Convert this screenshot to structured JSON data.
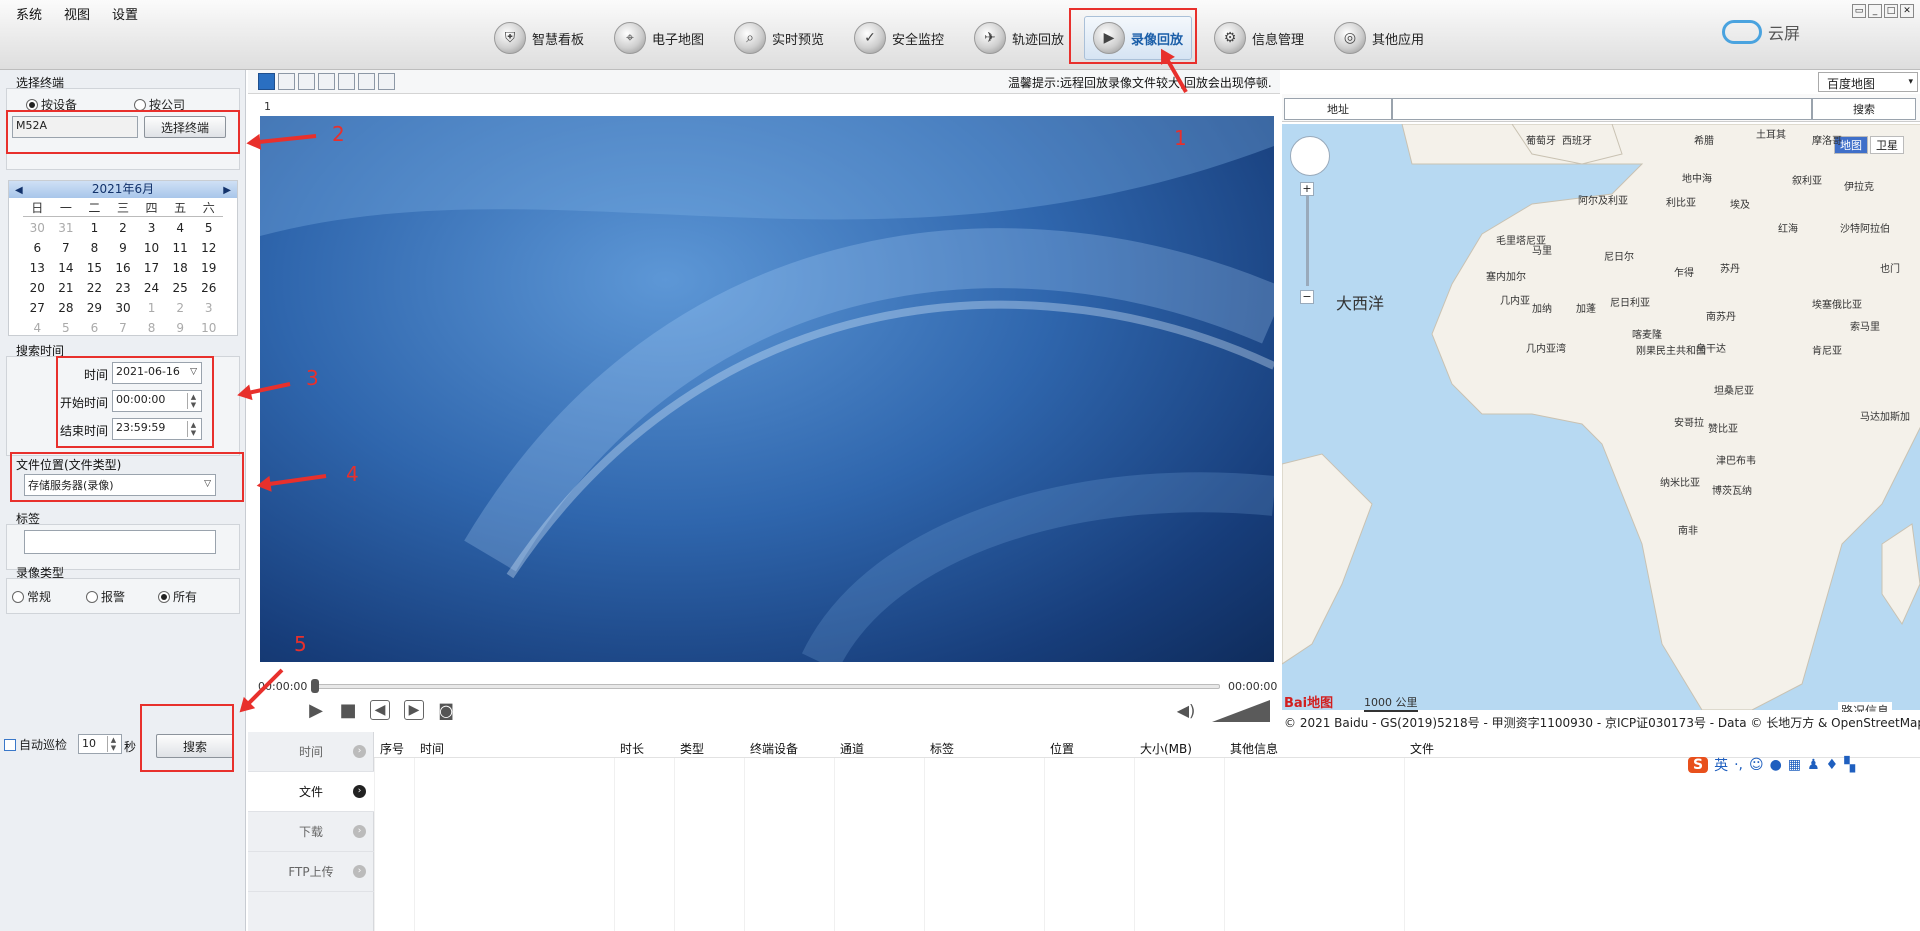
{
  "menu": [
    "系统",
    "视图",
    "设置"
  ],
  "nav": [
    {
      "label": "智慧看板",
      "icon": "shield-icon"
    },
    {
      "label": "电子地图",
      "icon": "map-pin-icon"
    },
    {
      "label": "实时预览",
      "icon": "search-icon"
    },
    {
      "label": "安全监控",
      "icon": "shield-check-icon"
    },
    {
      "label": "轨迹回放",
      "icon": "track-icon"
    },
    {
      "label": "录像回放",
      "icon": "playback-icon"
    },
    {
      "label": "信息管理",
      "icon": "gear-icon"
    },
    {
      "label": "其他应用",
      "icon": "apps-icon"
    }
  ],
  "logo": "云屏",
  "terminal": {
    "title": "选择终端",
    "by_device": "按设备",
    "by_company": "按公司",
    "value": "M52A",
    "select_button": "选择终端"
  },
  "calendar": {
    "month": "2021年6月",
    "weekdays": [
      "日",
      "一",
      "二",
      "三",
      "四",
      "五",
      "六"
    ],
    "days": [
      "30",
      "31",
      "1",
      "2",
      "3",
      "4",
      "5",
      "6",
      "7",
      "8",
      "9",
      "10",
      "11",
      "12",
      "13",
      "14",
      "15",
      "16",
      "17",
      "18",
      "19",
      "20",
      "21",
      "22",
      "23",
      "24",
      "25",
      "26",
      "27",
      "28",
      "29",
      "30",
      "1",
      "2",
      "3",
      "4",
      "5",
      "6",
      "7",
      "8",
      "9",
      "10"
    ]
  },
  "search_time": {
    "title": "搜索时间",
    "date_label": "时间",
    "date_value": "2021-06-16",
    "start_label": "开始时间",
    "start_value": "00:00:00",
    "end_label": "结束时间",
    "end_value": "23:59:59"
  },
  "file_location": {
    "title": "文件位置(文件类型)",
    "value": "存储服务器(录像)"
  },
  "tag": {
    "title": "标签",
    "value": ""
  },
  "record_type": {
    "title": "录像类型",
    "options": [
      "常规",
      "报警",
      "所有"
    ],
    "selected": "所有"
  },
  "auto_patrol": {
    "label": "自动巡检",
    "value": "10",
    "unit": "秒"
  },
  "search_button": "搜索",
  "annotations": [
    "1",
    "2",
    "3",
    "4",
    "5"
  ],
  "hint": "温馨提示:远程回放录像文件较大,回放会出现停顿.",
  "channel": "1",
  "player": {
    "current": "00:00:00",
    "total": "00:00:00",
    "progress": 0
  },
  "map": {
    "type": "百度地图",
    "address_label": "地址",
    "search": "搜索",
    "map_tab": "地图",
    "satellite_tab": "卫星",
    "ocean": "大西洋",
    "scale": "1000 公里",
    "traffic": "路况信息",
    "copyright": "© 2021 Baidu - GS(2019)5218号 - 甲测资字1100930 - 京ICP证030173号 - Data © 长地万方 & OpenStreetMap & HERE",
    "brand": "Bai地图",
    "labels": [
      "葡萄牙",
      "西班牙",
      "希腊",
      "土耳其",
      "摩洛哥",
      "地中海",
      "叙利亚",
      "伊拉克",
      "阿尔及利亚",
      "利比亚",
      "埃及",
      "沙特阿拉伯",
      "毛里塔尼亚",
      "马里",
      "尼日尔",
      "乍得",
      "苏丹",
      "塞内加尔",
      "几内亚",
      "加纳",
      "尼日利亚",
      "南苏丹",
      "埃塞俄比亚",
      "索马里",
      "喀麦隆",
      "几内亚湾",
      "加蓬",
      "刚果民主共和国",
      "乌干达",
      "肯尼亚",
      "坦桑尼亚",
      "安哥拉",
      "赞比亚",
      "津巴布韦",
      "纳米比亚",
      "博茨瓦纳",
      "南非",
      "马达加斯加",
      "红海",
      "也门"
    ]
  },
  "tabs": [
    "时间",
    "文件",
    "下载",
    "FTP上传"
  ],
  "active_tab": "文件",
  "columns": [
    "序号",
    "时间",
    "时长",
    "类型",
    "终端设备",
    "通道",
    "标签",
    "位置",
    "大小(MB)",
    "其他信息",
    "文件"
  ],
  "ime": "英"
}
